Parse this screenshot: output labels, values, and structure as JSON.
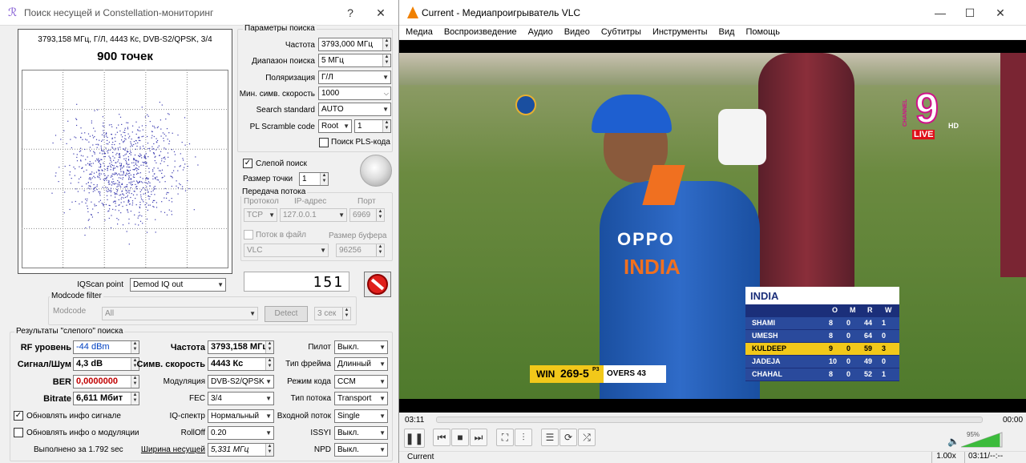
{
  "left": {
    "title": "Поиск несущей и Constellation-мониторинг",
    "help": "?",
    "close": "✕",
    "constellation": {
      "header": "3793,158 МГц, Г/Л, 4443 Кс, DVB-S2/QPSK, 3/4",
      "points_label": "900 точек"
    },
    "search_params": {
      "legend": "Параметры поиска",
      "frequency_label": "Частота",
      "frequency_value": "3793,000 МГц",
      "range_label": "Диапазон поиска",
      "range_value": "5 МГц",
      "polarization_label": "Поляризация",
      "polarization_value": "Г/Л",
      "min_symrate_label": "Мин. симв. скорость",
      "min_symrate_value": "1000",
      "standard_label": "Search standard",
      "standard_value": "AUTO",
      "plscramble_label": "PL Scramble code",
      "plscramble_mode": "Root",
      "plscramble_value": "1",
      "pls_search_label": "Поиск PLS-кода"
    },
    "blind": {
      "label": "Слепой поиск",
      "checked": true,
      "point_size_label": "Размер точки",
      "point_size_value": "1"
    },
    "stream": {
      "legend": "Передача потока",
      "protocol_label": "Протокол",
      "ip_label": "IP-адрес",
      "port_label": "Порт",
      "protocol_value": "TCP",
      "ip_value": "127.0.0.1",
      "port_value": "6969",
      "file_label": "Поток в файл",
      "buffer_label": "Размер буфера",
      "player_value": "VLC",
      "buffer_value": "96256"
    },
    "counter": "151",
    "iqscan": {
      "label": "IQScan point",
      "value": "Demod IQ out"
    },
    "modcode": {
      "legend": "Modcode filter",
      "label": "Modcode",
      "value": "All",
      "detect": "Detect",
      "seconds": "3 сек"
    },
    "results": {
      "legend": "Результаты \"слепого\" поиска",
      "rf_label": "RF уровень",
      "rf_value": "-44 dBm",
      "snr_label": "Сигнал/Шум",
      "snr_value": "4,3 dB",
      "ber_label": "BER",
      "ber_value": "0,0000000",
      "bitrate_label": "Bitrate",
      "bitrate_value": "6,611 Мбит",
      "upd_signal": "Обновлять инфо сигнале",
      "upd_mod": "Обновлять инфо о модуляции",
      "done": "Выполнено за 1.792 sec",
      "freq_label": "Частота",
      "freq_value": "3793,158 МГц",
      "symrate_label": "Симв. скорость",
      "symrate_value": "4443 Кс",
      "mod_label": "Модуляция",
      "mod_value": "DVB-S2/QPSK",
      "fec_label": "FEC",
      "fec_value": "3/4",
      "iq_label": "IQ-спектр",
      "iq_value": "Нормальный",
      "rolloff_label": "RollOff",
      "rolloff_value": "0.20",
      "bw_label": "Ширина несущей",
      "bw_value": "5,331 МГц",
      "pilot_label": "Пилот",
      "pilot_value": "Выкл.",
      "frame_label": "Тип фрейма",
      "frame_value": "Длинный",
      "codemode_label": "Режим кода",
      "codemode_value": "CCM",
      "streamtype_label": "Тип потока",
      "streamtype_value": "Transport",
      "input_label": "Входной поток",
      "input_value": "Single",
      "issyi_label": "ISSYI",
      "issyi_value": "Выкл.",
      "npd_label": "NPD",
      "npd_value": "Выкл."
    }
  },
  "vlc": {
    "title": "Current - Медиапроигрыватель VLC",
    "menu": [
      "Медиа",
      "Воспроизведение",
      "Аудио",
      "Видео",
      "Субтитры",
      "Инструменты",
      "Вид",
      "Помощь"
    ],
    "time_elapsed": "03:11",
    "time_total": "00:00",
    "volume": "95%",
    "status_left": "Current",
    "speed": "1.00x",
    "status_time": "03:11/--:--",
    "video": {
      "channel_name": "CHANNEL",
      "channel_num": "9",
      "hd": "HD",
      "live": "LIVE",
      "team": "INDIA",
      "cols": [
        "O",
        "M",
        "R",
        "W"
      ],
      "rows": [
        {
          "name": "SHAMI",
          "o": "8",
          "m": "0",
          "r": "44",
          "w": "1"
        },
        {
          "name": "UMESH",
          "o": "8",
          "m": "0",
          "r": "64",
          "w": "0"
        },
        {
          "name": "KULDEEP",
          "o": "9",
          "m": "0",
          "r": "59",
          "w": "3"
        },
        {
          "name": "JADEJA",
          "o": "10",
          "m": "0",
          "r": "49",
          "w": "0"
        },
        {
          "name": "CHAHAL",
          "o": "8",
          "m": "0",
          "r": "52",
          "w": "1"
        }
      ],
      "win_label": "WIN",
      "win_score": "269-5",
      "p3": "P3",
      "overs": "OVERS 43",
      "jersey": "OPPO",
      "jersey2": "INDIA"
    }
  }
}
